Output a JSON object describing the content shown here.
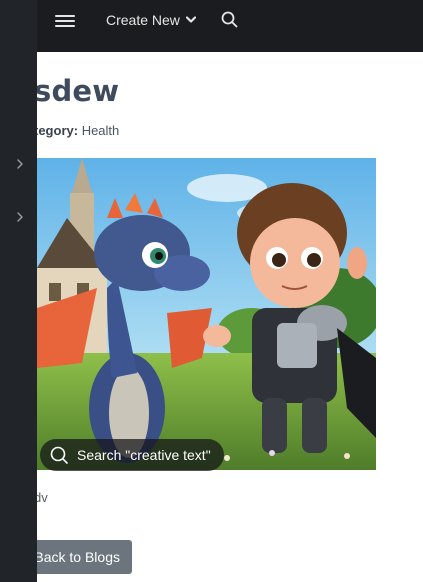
{
  "header": {
    "create_new_label": "Create New"
  },
  "post": {
    "title": "sdew",
    "category_label": "tegory:",
    "category_value": "Health",
    "body": "dv"
  },
  "image_overlay": {
    "search_text": "Search \"creative text\""
  },
  "actions": {
    "back_label": "Back to Blogs"
  },
  "icons": {
    "menu": "hamburger-icon",
    "create_dropdown": "chevron-down-icon",
    "search": "search-icon",
    "sidebar_1": "chevron-right-icon",
    "sidebar_2": "chevron-right-icon",
    "overlay_search": "search-icon"
  },
  "colors": {
    "topbar": "#1b1c1f",
    "sidebar": "#212529",
    "title": "#3d4b5c",
    "back_button": "#6c757d"
  }
}
